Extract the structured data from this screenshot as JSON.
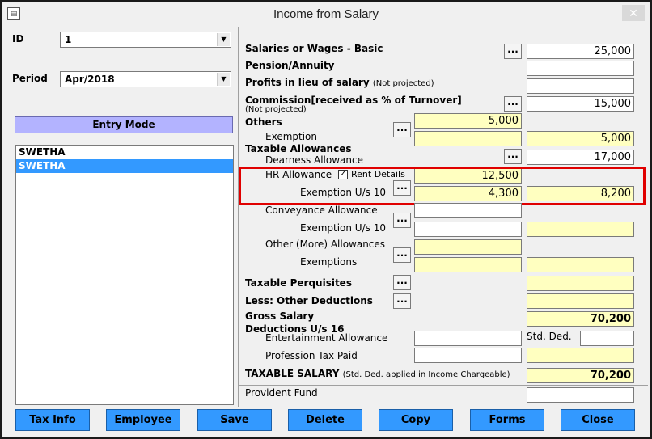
{
  "window": {
    "title": "Income from Salary",
    "close_glyph": "✕"
  },
  "left": {
    "id_label": "ID",
    "id_value": "1",
    "period_label": "Period",
    "period_value": "Apr/2018",
    "entry_mode": "Entry Mode",
    "list_items": [
      "SWETHA",
      "SWETHA"
    ]
  },
  "form": {
    "salaries_label": "Salaries or Wages - Basic",
    "salaries_value": "25,000",
    "pension_label": "Pension/Annuity",
    "profits_label": "Profits in lieu of salary",
    "profits_note": "(Not projected)",
    "commission_label": "Commission[received as % of Turnover]",
    "commission_note": "(Not projected)",
    "commission_value": "15,000",
    "others_label": "Others",
    "others_value": "5,000",
    "exemption_label": "Exemption",
    "exemption_value": "5,000",
    "taxable_allowances_label": "Taxable Allowances",
    "dearness_label": "Dearness Allowance",
    "dearness_value": "17,000",
    "hr_label": "HR Allowance",
    "rent_details_label": "Rent Details",
    "hr_value": "12,500",
    "hr_exemption_label": "Exemption U/s 10",
    "hr_exemption_value1": "4,300",
    "hr_exemption_value2": "8,200",
    "conveyance_label": "Conveyance Allowance",
    "conv_exemption_label": "Exemption U/s 10",
    "other_allow_label": "Other (More) Allowances",
    "other_exemptions_label": "Exemptions",
    "perquisites_label": "Taxable Perquisites",
    "less_deductions_label": "Less: Other Deductions",
    "gross_label": "Gross Salary",
    "gross_value": "70,200",
    "deductions_label": "Deductions U/s 16",
    "entertainment_label": "Entertainment Allowance",
    "std_ded_label": "Std. Ded.",
    "prof_tax_label": "Profession Tax Paid",
    "taxable_salary_label": "TAXABLE SALARY",
    "taxable_salary_note": "(Std. Ded. applied in Income Chargeable)",
    "taxable_salary_value": "70,200",
    "pf_label": "Provident Fund",
    "dots": "..."
  },
  "buttons": {
    "tax_info": "Tax Info",
    "employee": "Employee",
    "save": "Save",
    "delete": "Delete",
    "copy": "Copy",
    "forms": "Forms",
    "close": "Close"
  },
  "colors": {
    "accent": "#3399ff",
    "entry_mode": "#b3b3ff",
    "highlight_field": "#ffffc0",
    "red_box": "#e00000"
  }
}
